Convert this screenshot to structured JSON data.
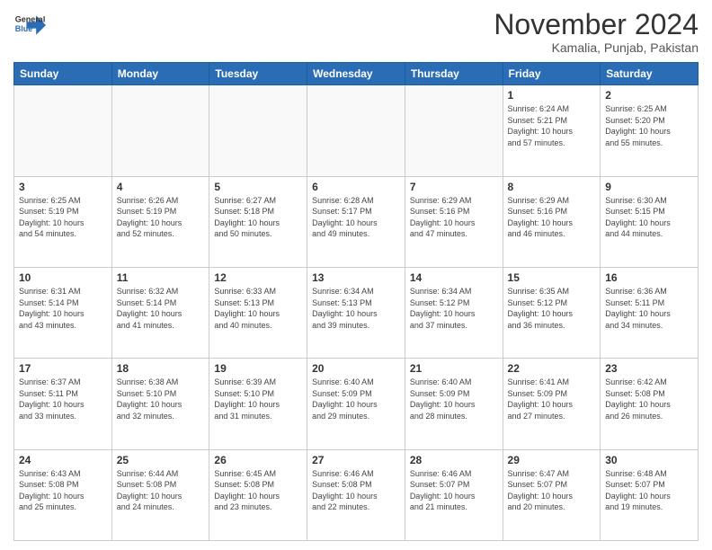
{
  "header": {
    "logo_line1": "General",
    "logo_line2": "Blue",
    "month": "November 2024",
    "location": "Kamalia, Punjab, Pakistan"
  },
  "weekdays": [
    "Sunday",
    "Monday",
    "Tuesday",
    "Wednesday",
    "Thursday",
    "Friday",
    "Saturday"
  ],
  "weeks": [
    [
      {
        "day": "",
        "info": ""
      },
      {
        "day": "",
        "info": ""
      },
      {
        "day": "",
        "info": ""
      },
      {
        "day": "",
        "info": ""
      },
      {
        "day": "",
        "info": ""
      },
      {
        "day": "1",
        "info": "Sunrise: 6:24 AM\nSunset: 5:21 PM\nDaylight: 10 hours\nand 57 minutes."
      },
      {
        "day": "2",
        "info": "Sunrise: 6:25 AM\nSunset: 5:20 PM\nDaylight: 10 hours\nand 55 minutes."
      }
    ],
    [
      {
        "day": "3",
        "info": "Sunrise: 6:25 AM\nSunset: 5:19 PM\nDaylight: 10 hours\nand 54 minutes."
      },
      {
        "day": "4",
        "info": "Sunrise: 6:26 AM\nSunset: 5:19 PM\nDaylight: 10 hours\nand 52 minutes."
      },
      {
        "day": "5",
        "info": "Sunrise: 6:27 AM\nSunset: 5:18 PM\nDaylight: 10 hours\nand 50 minutes."
      },
      {
        "day": "6",
        "info": "Sunrise: 6:28 AM\nSunset: 5:17 PM\nDaylight: 10 hours\nand 49 minutes."
      },
      {
        "day": "7",
        "info": "Sunrise: 6:29 AM\nSunset: 5:16 PM\nDaylight: 10 hours\nand 47 minutes."
      },
      {
        "day": "8",
        "info": "Sunrise: 6:29 AM\nSunset: 5:16 PM\nDaylight: 10 hours\nand 46 minutes."
      },
      {
        "day": "9",
        "info": "Sunrise: 6:30 AM\nSunset: 5:15 PM\nDaylight: 10 hours\nand 44 minutes."
      }
    ],
    [
      {
        "day": "10",
        "info": "Sunrise: 6:31 AM\nSunset: 5:14 PM\nDaylight: 10 hours\nand 43 minutes."
      },
      {
        "day": "11",
        "info": "Sunrise: 6:32 AM\nSunset: 5:14 PM\nDaylight: 10 hours\nand 41 minutes."
      },
      {
        "day": "12",
        "info": "Sunrise: 6:33 AM\nSunset: 5:13 PM\nDaylight: 10 hours\nand 40 minutes."
      },
      {
        "day": "13",
        "info": "Sunrise: 6:34 AM\nSunset: 5:13 PM\nDaylight: 10 hours\nand 39 minutes."
      },
      {
        "day": "14",
        "info": "Sunrise: 6:34 AM\nSunset: 5:12 PM\nDaylight: 10 hours\nand 37 minutes."
      },
      {
        "day": "15",
        "info": "Sunrise: 6:35 AM\nSunset: 5:12 PM\nDaylight: 10 hours\nand 36 minutes."
      },
      {
        "day": "16",
        "info": "Sunrise: 6:36 AM\nSunset: 5:11 PM\nDaylight: 10 hours\nand 34 minutes."
      }
    ],
    [
      {
        "day": "17",
        "info": "Sunrise: 6:37 AM\nSunset: 5:11 PM\nDaylight: 10 hours\nand 33 minutes."
      },
      {
        "day": "18",
        "info": "Sunrise: 6:38 AM\nSunset: 5:10 PM\nDaylight: 10 hours\nand 32 minutes."
      },
      {
        "day": "19",
        "info": "Sunrise: 6:39 AM\nSunset: 5:10 PM\nDaylight: 10 hours\nand 31 minutes."
      },
      {
        "day": "20",
        "info": "Sunrise: 6:40 AM\nSunset: 5:09 PM\nDaylight: 10 hours\nand 29 minutes."
      },
      {
        "day": "21",
        "info": "Sunrise: 6:40 AM\nSunset: 5:09 PM\nDaylight: 10 hours\nand 28 minutes."
      },
      {
        "day": "22",
        "info": "Sunrise: 6:41 AM\nSunset: 5:09 PM\nDaylight: 10 hours\nand 27 minutes."
      },
      {
        "day": "23",
        "info": "Sunrise: 6:42 AM\nSunset: 5:08 PM\nDaylight: 10 hours\nand 26 minutes."
      }
    ],
    [
      {
        "day": "24",
        "info": "Sunrise: 6:43 AM\nSunset: 5:08 PM\nDaylight: 10 hours\nand 25 minutes."
      },
      {
        "day": "25",
        "info": "Sunrise: 6:44 AM\nSunset: 5:08 PM\nDaylight: 10 hours\nand 24 minutes."
      },
      {
        "day": "26",
        "info": "Sunrise: 6:45 AM\nSunset: 5:08 PM\nDaylight: 10 hours\nand 23 minutes."
      },
      {
        "day": "27",
        "info": "Sunrise: 6:46 AM\nSunset: 5:08 PM\nDaylight: 10 hours\nand 22 minutes."
      },
      {
        "day": "28",
        "info": "Sunrise: 6:46 AM\nSunset: 5:07 PM\nDaylight: 10 hours\nand 21 minutes."
      },
      {
        "day": "29",
        "info": "Sunrise: 6:47 AM\nSunset: 5:07 PM\nDaylight: 10 hours\nand 20 minutes."
      },
      {
        "day": "30",
        "info": "Sunrise: 6:48 AM\nSunset: 5:07 PM\nDaylight: 10 hours\nand 19 minutes."
      }
    ]
  ]
}
